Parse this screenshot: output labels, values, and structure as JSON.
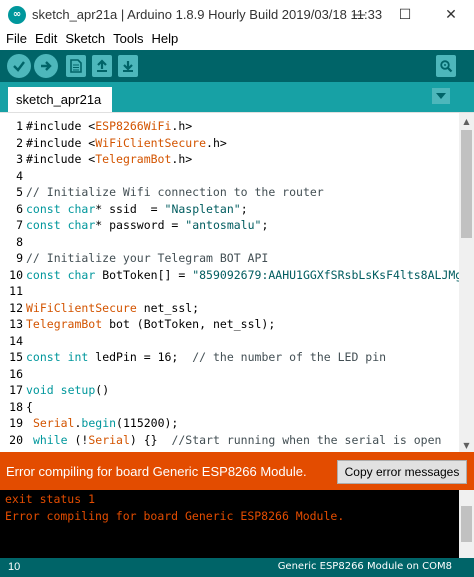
{
  "window": {
    "title": "sketch_apr21a | Arduino 1.8.9 Hourly Build 2019/03/18 11:33",
    "app_icon_glyph": "∞",
    "minimize_glyph": "—",
    "maximize_glyph": "☐",
    "close_glyph": "✕"
  },
  "menu": {
    "items": [
      "File",
      "Edit",
      "Sketch",
      "Tools",
      "Help"
    ]
  },
  "toolbar": {
    "buttons": [
      {
        "icon": "verify-check-icon"
      },
      {
        "icon": "upload-arrow-icon"
      },
      {
        "icon": "new-sketch-icon"
      },
      {
        "icon": "open-sketch-icon"
      },
      {
        "icon": "save-sketch-icon"
      },
      {
        "icon": "serial-monitor-icon"
      }
    ]
  },
  "tabs": {
    "active": "sketch_apr21a",
    "menu_glyph": "▼"
  },
  "editor": {
    "lines": [
      {
        "n": "1",
        "parts": [
          [
            "src",
            "#include <"
          ],
          [
            "cls",
            "ESP8266WiFi"
          ],
          [
            "src",
            ".h>"
          ]
        ]
      },
      {
        "n": "2",
        "parts": [
          [
            "src",
            "#include <"
          ],
          [
            "cls",
            "WiFiClientSecure"
          ],
          [
            "src",
            ".h>"
          ]
        ]
      },
      {
        "n": "3",
        "parts": [
          [
            "src",
            "#include <"
          ],
          [
            "cls",
            "TelegramBot"
          ],
          [
            "src",
            ".h>"
          ]
        ]
      },
      {
        "n": "4",
        "parts": []
      },
      {
        "n": "5",
        "parts": [
          [
            "cmt",
            "// Initialize Wifi connection to the router"
          ]
        ]
      },
      {
        "n": "6",
        "parts": [
          [
            "kw",
            "const"
          ],
          [
            "src",
            " "
          ],
          [
            "kw",
            "char"
          ],
          [
            "src",
            "* ssid  = "
          ],
          [
            "str",
            "\"Naspletan\""
          ],
          [
            "src",
            ";"
          ]
        ]
      },
      {
        "n": "7",
        "parts": [
          [
            "kw",
            "const"
          ],
          [
            "src",
            " "
          ],
          [
            "kw",
            "char"
          ],
          [
            "src",
            "* password = "
          ],
          [
            "str",
            "\"antosmalu\""
          ],
          [
            "src",
            ";"
          ]
        ]
      },
      {
        "n": "8",
        "parts": []
      },
      {
        "n": "9",
        "parts": [
          [
            "cmt",
            "// Initialize your Telegram BOT API"
          ]
        ]
      },
      {
        "n": "10",
        "parts": [
          [
            "kw",
            "const"
          ],
          [
            "src",
            " "
          ],
          [
            "kw",
            "char"
          ],
          [
            "src",
            " BotToken[] = "
          ],
          [
            "str",
            "\"859092679:AAHU1GGXfSRsbLsKsF4lts8ALJMg"
          ]
        ]
      },
      {
        "n": "11",
        "parts": []
      },
      {
        "n": "12",
        "parts": [
          [
            "cls",
            "WiFiClientSecure"
          ],
          [
            "src",
            " net_ssl;"
          ]
        ]
      },
      {
        "n": "13",
        "parts": [
          [
            "cls",
            "TelegramBot"
          ],
          [
            "src",
            " bot (BotToken, net_ssl);"
          ]
        ]
      },
      {
        "n": "14",
        "parts": []
      },
      {
        "n": "15",
        "parts": [
          [
            "kw",
            "const"
          ],
          [
            "src",
            " "
          ],
          [
            "kw",
            "int"
          ],
          [
            "src",
            " ledPin = 16;  "
          ],
          [
            "cmt",
            "// the number of the LED pin"
          ]
        ]
      },
      {
        "n": "16",
        "parts": []
      },
      {
        "n": "17",
        "parts": [
          [
            "kw",
            "void"
          ],
          [
            "src",
            " "
          ],
          [
            "kw",
            "setup"
          ],
          [
            "src",
            "()"
          ]
        ]
      },
      {
        "n": "18",
        "parts": [
          [
            "src",
            "{"
          ]
        ]
      },
      {
        "n": "19",
        "parts": [
          [
            "src",
            " "
          ],
          [
            "cls",
            "Serial"
          ],
          [
            "src",
            "."
          ],
          [
            "kw",
            "begin"
          ],
          [
            "src",
            "(115200);"
          ]
        ]
      },
      {
        "n": "20",
        "parts": [
          [
            "src",
            " "
          ],
          [
            "kw",
            "while"
          ],
          [
            "src",
            " (!"
          ],
          [
            "cls",
            "Serial"
          ],
          [
            "src",
            ") {}  "
          ],
          [
            "cmt",
            "//Start running when the serial is open"
          ]
        ]
      }
    ],
    "scroll_up_glyph": "▲",
    "scroll_down_glyph": "▼"
  },
  "status": {
    "message": "Error compiling for board Generic ESP8266 Module.",
    "copy_button": "Copy error messages"
  },
  "console": {
    "lines": [
      "exit status 1",
      "Error compiling for board Generic ESP8266 Module."
    ]
  },
  "footer": {
    "line_number": "10",
    "board": "Generic ESP8266 Module on COM8"
  },
  "colors": {
    "toolbar_bg": "#006468",
    "tab_strip_bg": "#17a1a5",
    "error_bar_bg": "#e34c00",
    "console_bg": "#000000",
    "keyword": "#00979c",
    "class_name": "#d35400"
  }
}
